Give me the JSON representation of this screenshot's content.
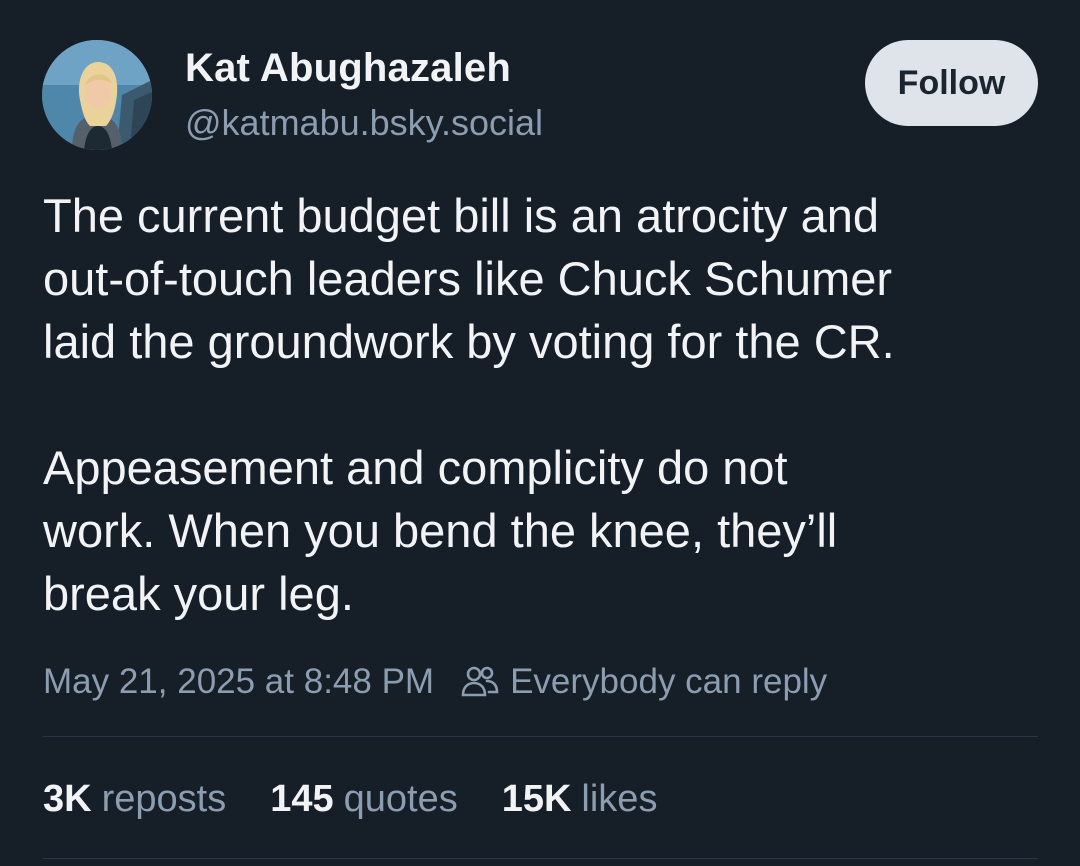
{
  "author": {
    "display_name": "Kat Abughazaleh",
    "handle": "@katmabu.bsky.social",
    "avatar_icon": "profile-photo"
  },
  "follow_button": {
    "label": "Follow"
  },
  "post": {
    "paragraphs": [
      {
        "lines": [
          "The current budget bill is an atrocity and",
          "out-of-touch leaders like Chuck Schumer",
          "laid the groundwork by voting for the CR."
        ]
      },
      {
        "lines": [
          "Appeasement and complicity do not",
          "work. When you bend the knee, they’ll",
          "break your leg."
        ]
      }
    ],
    "timestamp": "May 21, 2025 at 8:48 PM",
    "reply_setting": "Everybody can reply",
    "reply_setting_icon": "people-icon"
  },
  "stats": {
    "reposts": {
      "count": "3K",
      "label": "reposts"
    },
    "quotes": {
      "count": "145",
      "label": "quotes"
    },
    "likes": {
      "count": "15K",
      "label": "likes"
    }
  },
  "colors": {
    "background": "#161e27",
    "primary_text": "#f1f3f5",
    "secondary_text": "#8c9db1",
    "follow_button_bg": "#dfe4ea",
    "divider": "#2b3744"
  }
}
